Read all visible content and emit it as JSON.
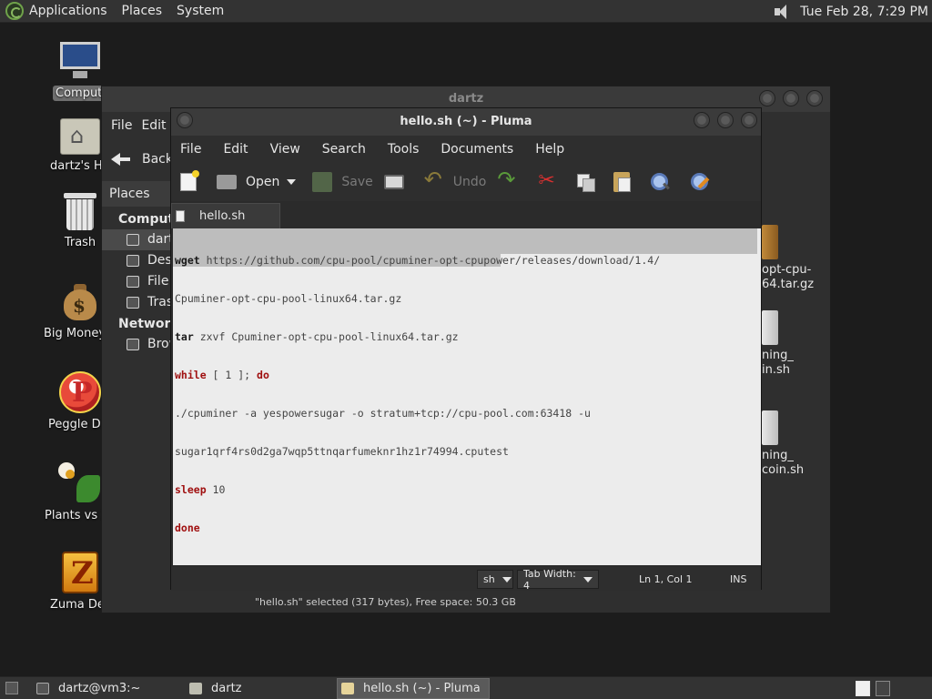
{
  "top_panel": {
    "menus": [
      "Applications",
      "Places",
      "System"
    ],
    "clock": "Tue Feb 28,  7:29 PM"
  },
  "desktop_icons": [
    {
      "label": "Computer",
      "icon": "computer-icon"
    },
    {
      "label": "dartz's Home",
      "icon": "home-folder-icon"
    },
    {
      "label": "Trash",
      "icon": "trash-icon"
    },
    {
      "label": "Big Money Deluxe",
      "icon": "money-bag-icon"
    },
    {
      "label": "Peggle Deluxe",
      "icon": "peggle-icon"
    },
    {
      "label": "Plants vs Zombies",
      "icon": "plants-icon"
    },
    {
      "label": "Zuma Deluxe",
      "icon": "zuma-icon"
    }
  ],
  "file_manager": {
    "title": "dartz",
    "menus": [
      "File",
      "Edit"
    ],
    "back_label": "Back",
    "places_label": "Places",
    "sidebar": {
      "computer_section": "Computer",
      "items": [
        "dartz",
        "Desktop",
        "File System",
        "Trash"
      ],
      "network_section": "Network",
      "network_items": [
        "Browse Network"
      ]
    },
    "files": [
      {
        "line1": "opt-cpu-",
        "line2": "64.tar.gz"
      },
      {
        "line1": "ning_",
        "line2": "in.sh"
      },
      {
        "line1": "ning_",
        "line2": "coin.sh"
      }
    ],
    "status": "\"hello.sh\" selected (317 bytes), Free space: 50.3 GB"
  },
  "pluma": {
    "title": "hello.sh (~) - Pluma",
    "menus": [
      "File",
      "Edit",
      "View",
      "Search",
      "Tools",
      "Documents",
      "Help"
    ],
    "toolbar": {
      "open_label": "Open",
      "save_label": "Save",
      "undo_label": "Undo"
    },
    "tab_label": "hello.sh",
    "code_lines": {
      "l1_cmd": "wget",
      "l1_rest": " https://github.com/cpu-pool/cpuminer-opt-cpupower/releases/download/1.4/",
      "l2": "Cpuminer-opt-cpu-pool-linux64.tar.gz",
      "l3_cmd": "tar",
      "l3_rest": " zxvf Cpuminer-opt-cpu-pool-linux64.tar.gz",
      "l4_kw": "while",
      "l4_mid": " [ 1 ]; ",
      "l4_kw2": "do",
      "l5": "./cpuminer -a yespowersugar -o stratum+tcp://cpu-pool.com:63418 -u",
      "l6": "sugar1qrf4rs0d2ga7wqp5ttnqarfumeknr1hz1r74994.cputest",
      "l7_kw": "sleep",
      "l7_rest": " 10",
      "l8_kw": "done"
    },
    "statusbar": {
      "language": "sh",
      "tab_width": "Tab Width:  4",
      "position": "Ln 1, Col 1",
      "mode": "INS"
    }
  },
  "bottom_panel": {
    "tasks": [
      "dartz@vm3:~",
      "dartz",
      "hello.sh (~) - Pluma"
    ]
  }
}
